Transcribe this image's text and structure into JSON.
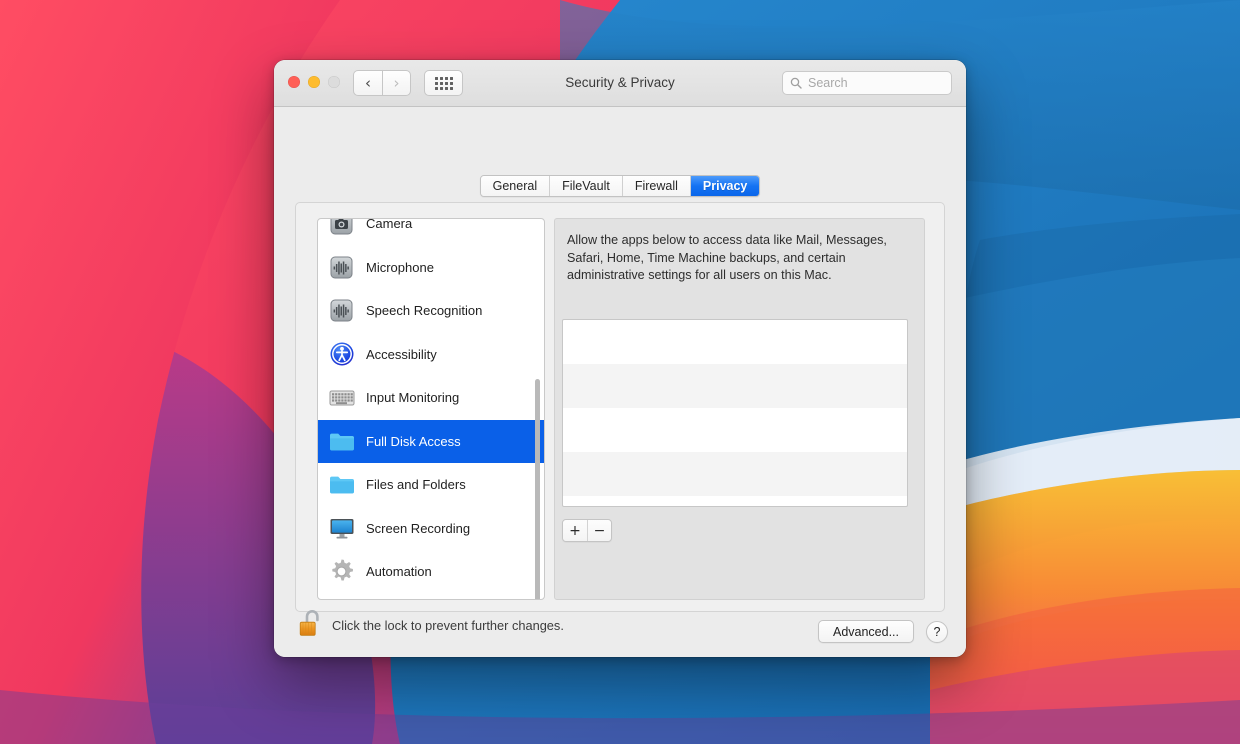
{
  "window": {
    "title": "Security & Privacy",
    "traffic_lights": [
      {
        "name": "close",
        "color": "#ff5f57",
        "enabled": true
      },
      {
        "name": "minimize",
        "color": "#febc2e",
        "enabled": true
      },
      {
        "name": "zoom",
        "color": "#dcdcdc",
        "enabled": false
      }
    ],
    "nav": {
      "back_icon": "chevron-left-icon",
      "forward_icon": "chevron-right-icon",
      "back_enabled": true,
      "forward_enabled": false
    },
    "grid_button_icon": "grid-view-icon"
  },
  "search": {
    "placeholder": "Search",
    "value": "",
    "icon": "search-icon"
  },
  "tabs": [
    {
      "label": "General",
      "active": false
    },
    {
      "label": "FileVault",
      "active": false
    },
    {
      "label": "Firewall",
      "active": false
    },
    {
      "label": "Privacy",
      "active": true
    }
  ],
  "sidebar": {
    "items": [
      {
        "label": "Camera",
        "icon": "camera-icon",
        "selected": false
      },
      {
        "label": "Microphone",
        "icon": "microphone-icon",
        "selected": false
      },
      {
        "label": "Speech Recognition",
        "icon": "speech-recognition-icon",
        "selected": false
      },
      {
        "label": "Accessibility",
        "icon": "accessibility-icon",
        "selected": false
      },
      {
        "label": "Input Monitoring",
        "icon": "keyboard-icon",
        "selected": false
      },
      {
        "label": "Full Disk Access",
        "icon": "folder-icon",
        "selected": true
      },
      {
        "label": "Files and Folders",
        "icon": "folder-icon",
        "selected": false
      },
      {
        "label": "Screen Recording",
        "icon": "display-icon",
        "selected": false
      },
      {
        "label": "Automation",
        "icon": "gear-icon",
        "selected": false
      }
    ]
  },
  "detail": {
    "description": "Allow the apps below to access data like Mail, Messages, Safari, Home, Time Machine backups, and certain administrative settings for all users on this Mac.",
    "app_list": [],
    "add_label": "+",
    "remove_label": "−"
  },
  "footer": {
    "lock_icon": "unlocked-padlock-icon",
    "lock_text": "Click the lock to prevent further changes.",
    "advanced_label": "Advanced...",
    "help_label": "?"
  },
  "colors": {
    "accent_blue": "#0a60e8",
    "tab_active_blue": "#1573f3",
    "lock_orange": "#eb9119",
    "window_bg": "#ececec",
    "panel_bg": "#f0f0f0",
    "list_bg": "#ffffff"
  }
}
